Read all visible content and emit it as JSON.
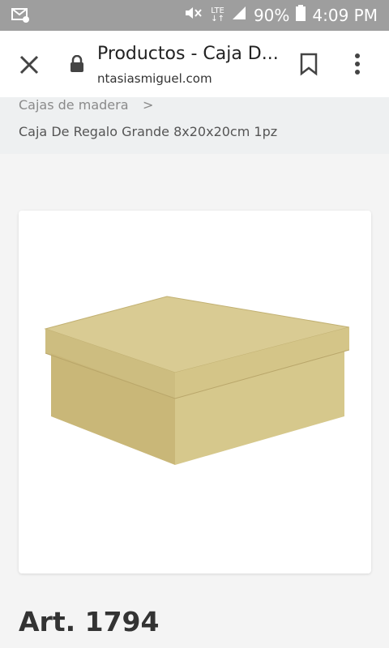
{
  "status_bar": {
    "time": "4:09 PM",
    "battery": "90%",
    "network": "LTE",
    "icons": [
      "mail-icon",
      "mute-icon",
      "lte-icon",
      "signal-icon",
      "battery-icon"
    ]
  },
  "browser": {
    "title": "Productos - Caja D...",
    "url": "ntasiasmiguel.com",
    "icons": [
      "close-icon",
      "lock-icon",
      "bookmark-icon",
      "more-vert-icon"
    ]
  },
  "breadcrumb": {
    "parent": "Cajas de madera",
    "separator": ">",
    "current": "Caja De Regalo Grande 8x20x20cm 1pz"
  },
  "product": {
    "image_alt": "box-image",
    "article": "Art. 1794"
  },
  "colors": {
    "status_bar": "#9e9e9e",
    "progress_line": "#9ab3cc",
    "breadcrumb_bg": "#eef0f1",
    "box": "#d2c38a"
  }
}
